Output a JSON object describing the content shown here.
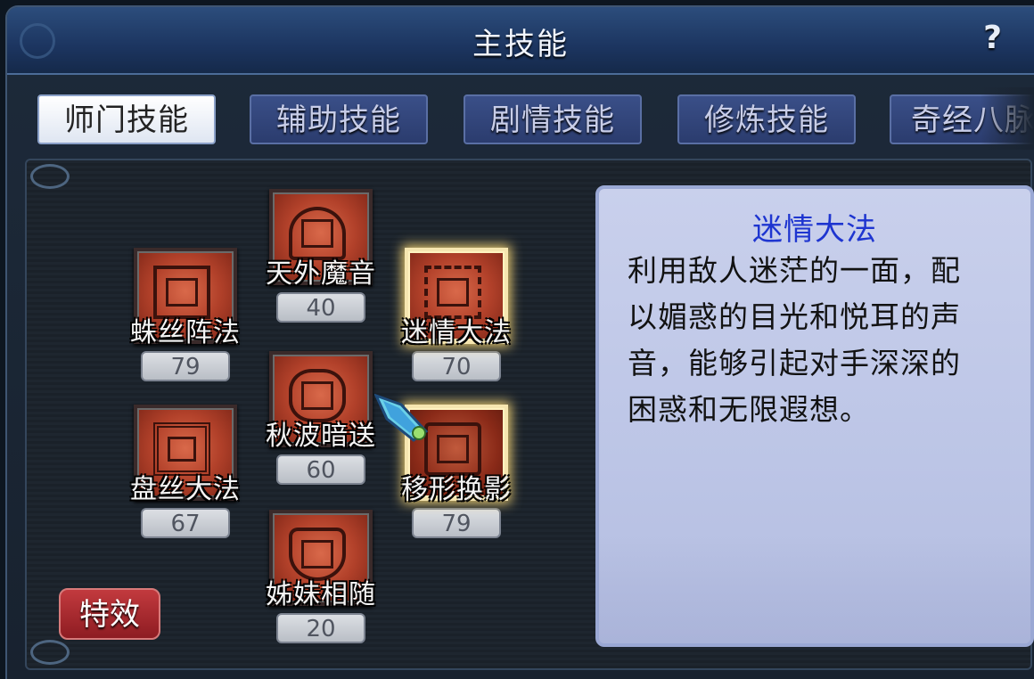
{
  "window": {
    "title": "主技能",
    "help_symbol": "?"
  },
  "tabs": [
    {
      "label": "师门技能",
      "active": true
    },
    {
      "label": "辅助技能",
      "active": false
    },
    {
      "label": "剧情技能",
      "active": false
    },
    {
      "label": "修炼技能",
      "active": false
    },
    {
      "label": "奇经八脉",
      "active": false
    }
  ],
  "skills": [
    {
      "name": "天外魔音",
      "level": "40"
    },
    {
      "name": "蛛丝阵法",
      "level": "79"
    },
    {
      "name": "迷情大法",
      "level": "70",
      "selected": true
    },
    {
      "name": "秋波暗送",
      "level": "60"
    },
    {
      "name": "盘丝大法",
      "level": "67"
    },
    {
      "name": "移形换影",
      "level": "79"
    },
    {
      "name": "姊妹相随",
      "level": "20"
    }
  ],
  "effect_button": {
    "label": "特效"
  },
  "description": {
    "title": "迷情大法",
    "lines": [
      "利用敌人迷茫的一面，配",
      "以媚惑的目光和悦耳的声",
      "音，能够引起对手深深的",
      "困惑和无限遐想。"
    ]
  },
  "colors": {
    "title_bar": "#1c3560",
    "description_title": "#1e35d0",
    "skill_icon": "#b2412a"
  }
}
